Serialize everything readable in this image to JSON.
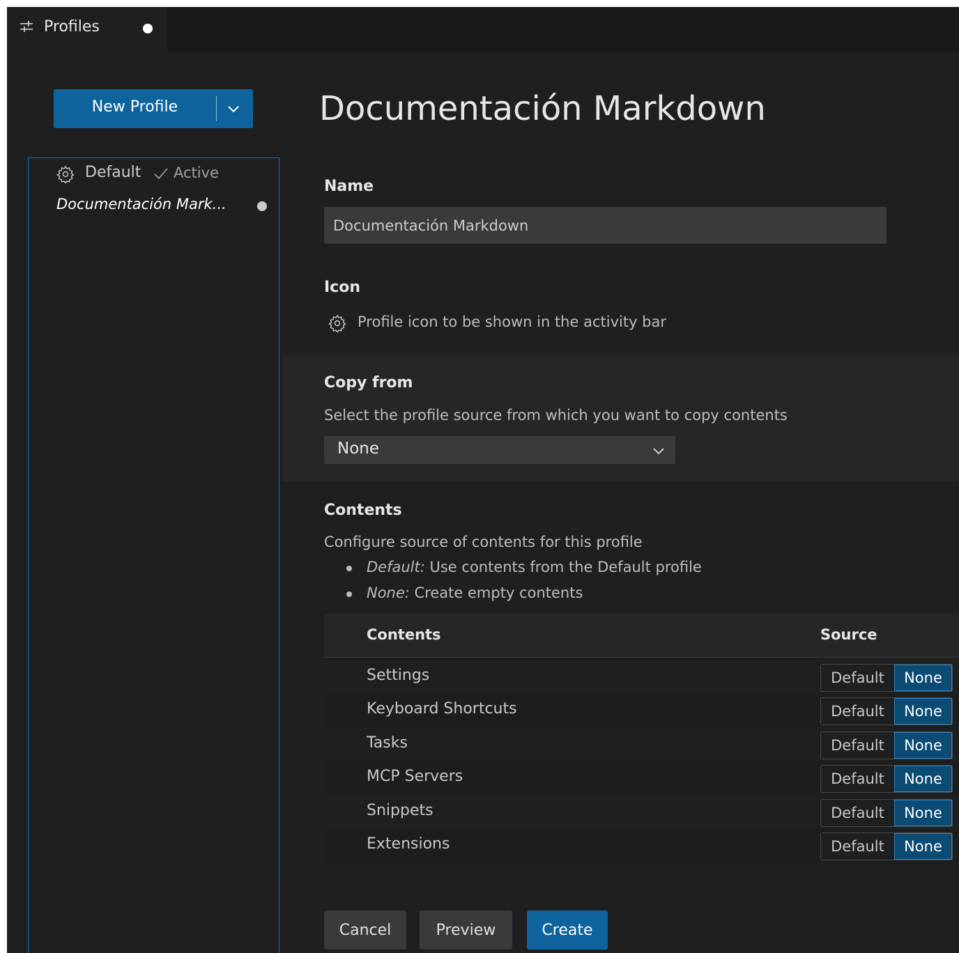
{
  "tab": {
    "label": "Profiles",
    "icon": "sliders-icon"
  },
  "sidebar": {
    "new_profile_label": "New Profile",
    "profiles": [
      {
        "label": "Default",
        "status": "Active",
        "icon": "gear-icon"
      },
      {
        "label": "Documentación Mark...",
        "dirty": true
      }
    ]
  },
  "main": {
    "title": "Documentación Markdown",
    "name_label": "Name",
    "name_value": "Documentación Markdown",
    "icon_label": "Icon",
    "icon_description": "Profile icon to be shown in the activity bar",
    "copy_from_label": "Copy from",
    "copy_from_description": "Select the profile source from which you want to copy contents",
    "copy_from_value": "None",
    "contents_label": "Contents",
    "contents_description": "Configure source of contents for this profile",
    "bullets": [
      {
        "term": "Default:",
        "text": " Use contents from the Default profile"
      },
      {
        "term": "None:",
        "text": " Create empty contents"
      }
    ],
    "table": {
      "col_contents": "Contents",
      "col_source": "Source",
      "option_default": "Default",
      "option_none": "None",
      "rows": [
        "Settings",
        "Keyboard Shortcuts",
        "Tasks",
        "MCP Servers",
        "Snippets",
        "Extensions"
      ]
    },
    "buttons": {
      "cancel": "Cancel",
      "preview": "Preview",
      "create": "Create"
    }
  },
  "colors": {
    "accent": "#0e639c",
    "background": "#1f1f1f",
    "focus_border": "#0e70c0"
  }
}
